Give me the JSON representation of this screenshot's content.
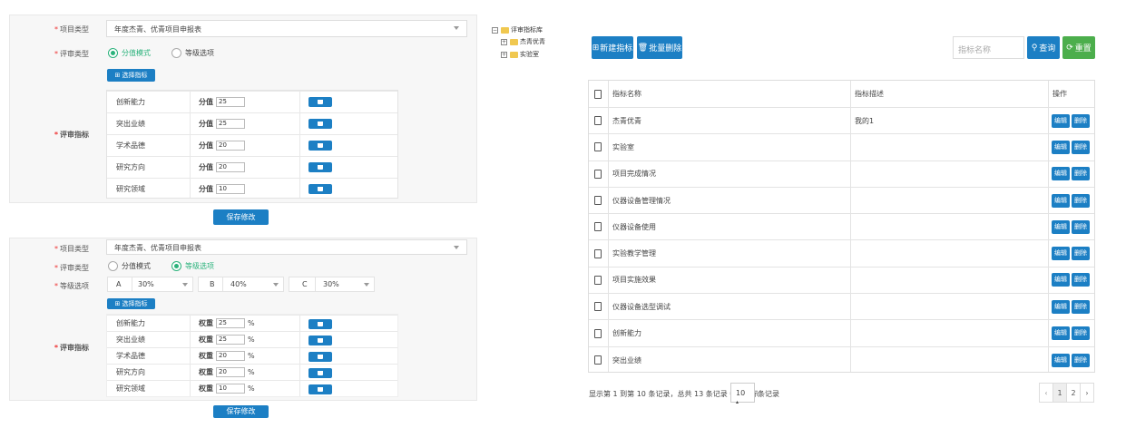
{
  "form_top": {
    "project_type_label": "项目类型",
    "project_type_value": "年度杰青、优青项目申报表",
    "review_type_label": "评审类型",
    "radio_score": "分值模式",
    "radio_level": "等级选项",
    "select_indicator_btn": "选择指标",
    "review_indicator_label": "评审指标",
    "field_label": "分值",
    "rows": [
      {
        "name": "创新能力",
        "value": "25"
      },
      {
        "name": "突出业绩",
        "value": "25"
      },
      {
        "name": "学术品德",
        "value": "20"
      },
      {
        "name": "研究方向",
        "value": "20"
      },
      {
        "name": "研究领域",
        "value": "10"
      }
    ],
    "save_btn": "保存修改"
  },
  "form_bottom": {
    "project_type_label": "项目类型",
    "project_type_value": "年度杰青、优青项目申报表",
    "review_type_label": "评审类型",
    "radio_score": "分值模式",
    "radio_level": "等级选项",
    "level_label": "等级选项",
    "levels": [
      {
        "grade": "A",
        "value": "30%"
      },
      {
        "grade": "B",
        "value": "40%"
      },
      {
        "grade": "C",
        "value": "30%"
      }
    ],
    "select_indicator_btn": "选择指标",
    "review_indicator_label": "评审指标",
    "field_label": "权重",
    "unit": "%",
    "rows": [
      {
        "name": "创新能力",
        "value": "25"
      },
      {
        "name": "突出业绩",
        "value": "25"
      },
      {
        "name": "学术品德",
        "value": "20"
      },
      {
        "name": "研究方向",
        "value": "20"
      },
      {
        "name": "研究领域",
        "value": "10"
      }
    ],
    "save_btn": "保存修改"
  },
  "tree": {
    "root": "评审指标库",
    "children": [
      "杰青优青",
      "实验室"
    ]
  },
  "toolbar": {
    "new_btn": "新建指标",
    "batch_delete_btn": "批量删除",
    "search_placeholder": "指标名称",
    "search_btn": "查询",
    "reset_btn": "重置"
  },
  "grid": {
    "headers": [
      "指标名称",
      "指标描述",
      "操作"
    ],
    "edit_label": "编辑",
    "delete_label": "删除",
    "rows": [
      {
        "name": "杰青优青",
        "desc": "我的1"
      },
      {
        "name": "实验室",
        "desc": ""
      },
      {
        "name": "项目完成情况",
        "desc": ""
      },
      {
        "name": "仪器设备管理情况",
        "desc": ""
      },
      {
        "name": "仪器设备使用",
        "desc": ""
      },
      {
        "name": "实验教学管理",
        "desc": ""
      },
      {
        "name": "项目实施效果",
        "desc": ""
      },
      {
        "name": "仪器设备选型调试",
        "desc": ""
      },
      {
        "name": "创新能力",
        "desc": ""
      },
      {
        "name": "突出业绩",
        "desc": ""
      }
    ]
  },
  "pagination": {
    "info_prefix": "显示第 1 到第 10 条记录，总共 13 条记录 每页显示",
    "page_size": "10",
    "info_suffix": "条记录",
    "prev": "‹",
    "pages": [
      "1",
      "2"
    ],
    "next": "›"
  },
  "colors": {
    "primary": "#1c7fc4",
    "success": "#2ab27b",
    "required": "#e33333"
  }
}
